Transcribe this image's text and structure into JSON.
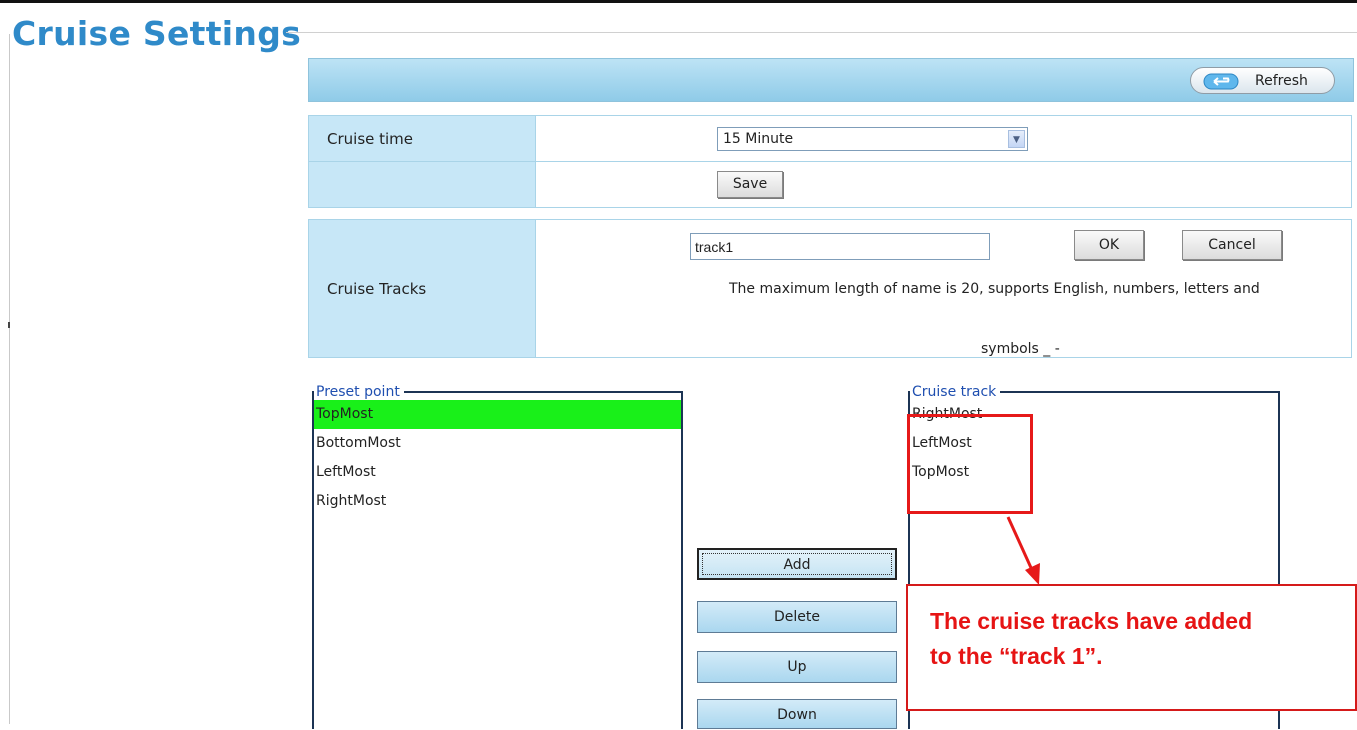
{
  "page": {
    "title": "Cruise Settings"
  },
  "header": {
    "refresh_label": "Refresh"
  },
  "cruise_time": {
    "label": "Cruise time",
    "selected": "15 Minute",
    "save_label": "Save"
  },
  "cruise_tracks": {
    "label": "Cruise Tracks",
    "name_value": "track1",
    "ok_label": "OK",
    "cancel_label": "Cancel",
    "hint_line1": "The maximum length of name is 20, supports English, numbers, letters and",
    "hint_line2": "symbols _ -"
  },
  "preset_point": {
    "legend": "Preset point",
    "items": [
      "TopMost",
      "BottomMost",
      "LeftMost",
      "RightMost"
    ],
    "selected_index": 0
  },
  "cruise_track": {
    "legend": "Cruise track",
    "items": [
      "RightMost",
      "LeftMost",
      "TopMost"
    ]
  },
  "actions": {
    "add": "Add",
    "delete": "Delete",
    "up": "Up",
    "down": "Down"
  },
  "annotation": {
    "line1": "The cruise tracks have added",
    "line2": "to the “track 1”."
  },
  "colors": {
    "title": "#2f8ac9",
    "selected_row": "#19f019",
    "annotation": "#e61919",
    "label_cell": "#c7e7f7"
  }
}
